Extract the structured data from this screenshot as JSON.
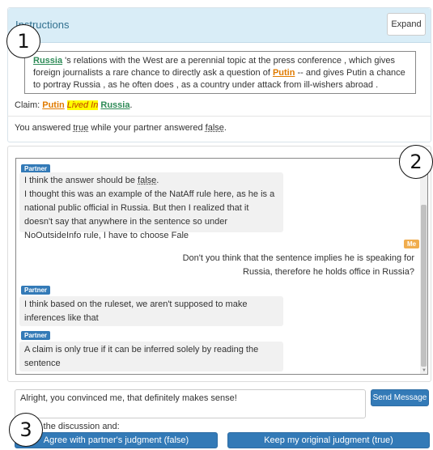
{
  "instructions": {
    "title": "Instructions",
    "expand_label": "Expand",
    "sentence": {
      "ent1": "Russia",
      "part1": " 's relations with the West are a perennial topic at the press conference , which gives foreign journalists a rare chance to directly ask a question of ",
      "ent2": "Putin",
      "part2": " -- and gives Putin a chance to portray Russia , as he often does , as a country under attack from ill-wishers abroad ."
    },
    "claim": {
      "label": "Claim: ",
      "subject": "Putin",
      "relation": "Lived In",
      "object": "Russia",
      "end": "."
    },
    "answer": {
      "prefix": "You answered ",
      "yours": "true",
      "middle": " while your partner answered ",
      "partners": "false",
      "end": "."
    }
  },
  "annotations": [
    "1",
    "2",
    "3"
  ],
  "chat": {
    "messages": [
      {
        "sender": "Partner",
        "lines": [
          "I think the answer should be ",
          "false",
          "."
        ],
        "text": "I thought this was an example of the NatAff rule here, as he is a national public official in Russia. But then I realized that it doesn't say that anywhere in the sentence so under NoOutsideInfo rule, I have to choose Fale"
      },
      {
        "sender": "Me",
        "text": "Don't you think that the sentence implies he is speaking for Russia, therefore he holds office in Russia?"
      },
      {
        "sender": "Partner",
        "text": "I think based on the ruleset, we aren't supposed to make inferences like that"
      },
      {
        "sender": "Partner",
        "text": "A claim is only true if it can be inferred solely by reading the sentence"
      }
    ]
  },
  "composer": {
    "value": "Alright, you convinced me, that definitely makes sense!",
    "send_label": "Send Message"
  },
  "exit": {
    "label": "it the discussion and:",
    "agree_label": "Agree with partner's judgment (false)",
    "keep_label": "Keep my original judgment (true)"
  },
  "colors": {
    "header_bg": "#d9edf7",
    "primary": "#337ab7",
    "me_badge": "#f0ad4e",
    "entity": "#2e8b57",
    "entity_alt": "#e07b00",
    "relation_highlight": "#ffff00"
  }
}
